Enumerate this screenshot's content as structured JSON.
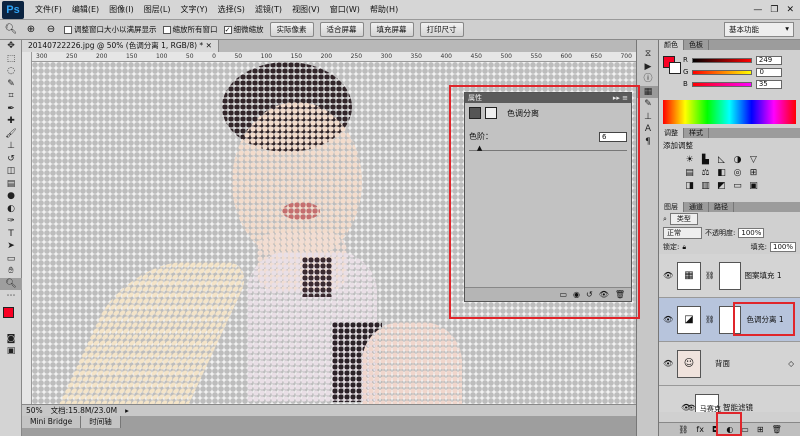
{
  "app": {
    "logo": "Ps"
  },
  "menubar": {
    "items": [
      "文件(F)",
      "编辑(E)",
      "图像(I)",
      "图层(L)",
      "文字(Y)",
      "选择(S)",
      "滤镜(T)",
      "视图(V)",
      "窗口(W)",
      "帮助(H)"
    ],
    "minimize": "—",
    "restore": "❐",
    "close": "✕"
  },
  "options": {
    "check_resize": "调整窗口大小以满屏显示",
    "check_zoom_all": "缩放所有窗口",
    "check_scrubby": "细微缩放",
    "btn_actual": "实际像素",
    "btn_fit": "适合屏幕",
    "btn_fill": "填充屏幕",
    "btn_print": "打印尺寸",
    "workspace": "基本功能"
  },
  "document": {
    "tab_title": "20140722226.jpg @ 50% (色调分离 1, RGB/8) *",
    "ruler_ticks": [
      "300",
      "250",
      "200",
      "150",
      "100",
      "50",
      "0",
      "50",
      "100",
      "150",
      "200",
      "250",
      "300",
      "350",
      "400",
      "450",
      "500",
      "550",
      "600",
      "650",
      "700"
    ],
    "zoom": "50%",
    "doc_size": "文档:15.8M/23.0M"
  },
  "bottom_tabs": [
    "Mini Bridge",
    "时间轴"
  ],
  "properties": {
    "header": "属性",
    "title": "色调分离",
    "level_label": "色阶：",
    "level_value": "6",
    "level_fraction": 0.05
  },
  "color_panel": {
    "tabs": [
      "颜色",
      "色板"
    ],
    "r_label": "R",
    "r_value": "249",
    "g_label": "G",
    "g_value": "0",
    "b_label": "B",
    "b_value": "35",
    "fg_color": "#f90023",
    "bg_color": "#ffffff"
  },
  "adjust_panel": {
    "tabs": [
      "调整",
      "样式"
    ],
    "title": "添加调整"
  },
  "layers_panel": {
    "tabs": [
      "图层",
      "通道",
      "路径"
    ],
    "filter": "类型",
    "blend_mode": "正常",
    "opacity_label": "不透明度:",
    "opacity_value": "100%",
    "lock_label": "锁定:",
    "fill_label": "填充:",
    "fill_value": "100%",
    "layers": [
      {
        "name": "图案填充 1"
      },
      {
        "name": "色调分离 1"
      },
      {
        "name": "背面"
      },
      {
        "name": "智能滤镜"
      },
      {
        "name": "马赛克"
      }
    ]
  },
  "colors": {
    "highlight": "#e0252b"
  }
}
